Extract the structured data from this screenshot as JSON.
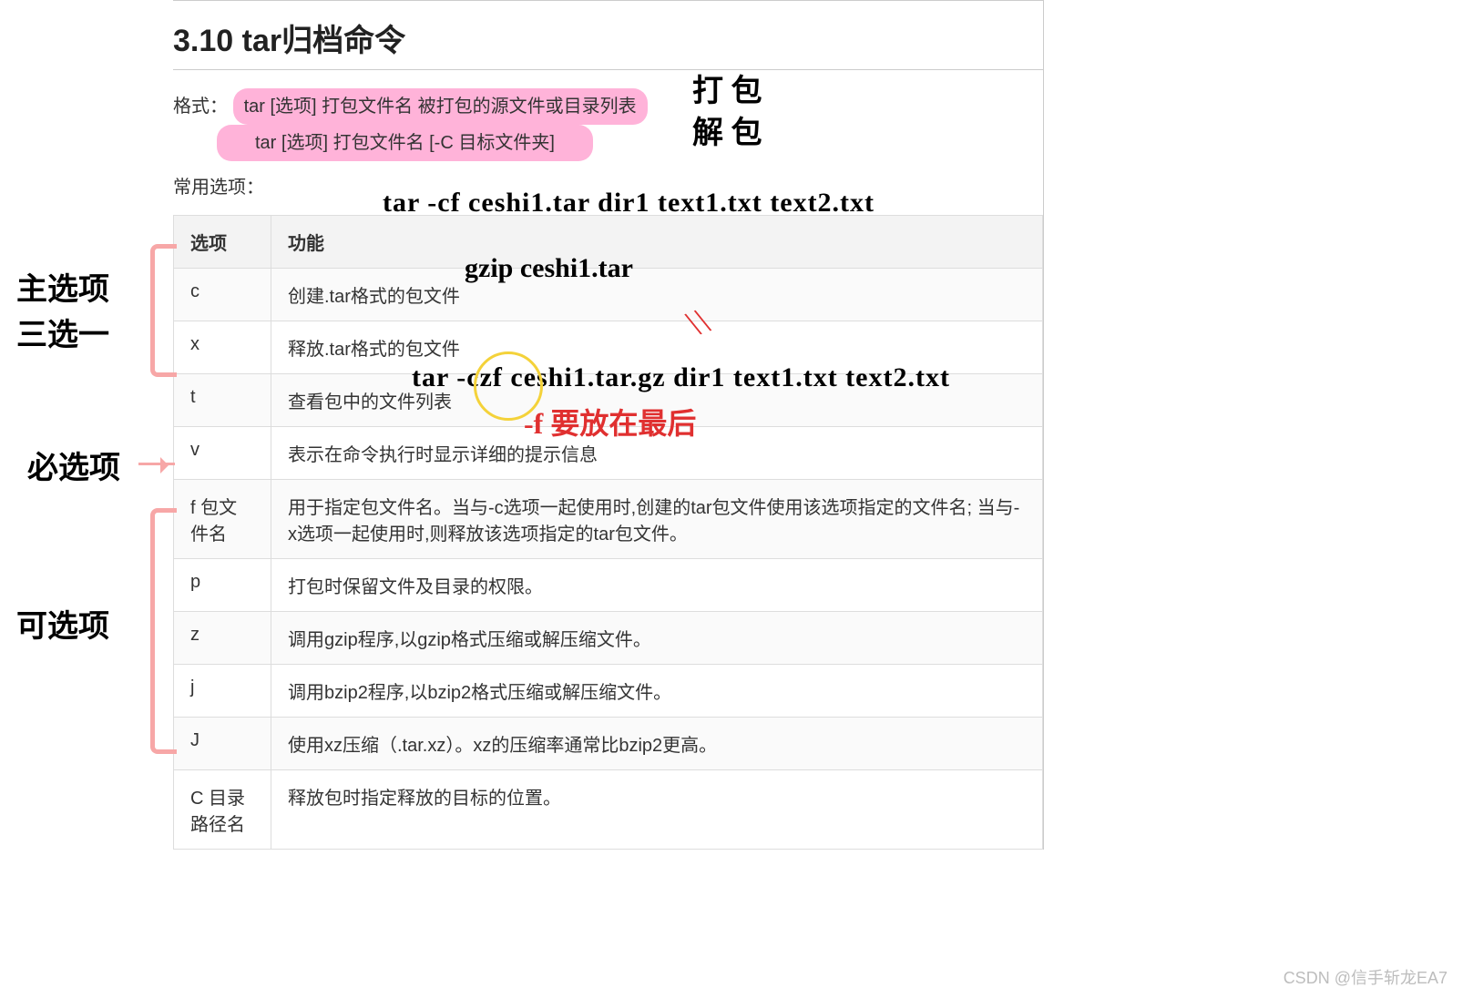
{
  "heading": "3.10 tar归档命令",
  "format_label": "格式：",
  "format_line1": "tar  [选项]  打包文件名  被打包的源文件或目录列表",
  "format_line2": "tar  [选项]  打包文件名  [-C  目标文件夹]",
  "common_opts_label": "常用选项：",
  "table": {
    "head_option": "选项",
    "head_function": "功能",
    "rows": [
      {
        "opt": "c",
        "desc": "创建.tar格式的包文件"
      },
      {
        "opt": "x",
        "desc": "释放.tar格式的包文件"
      },
      {
        "opt": "t",
        "desc": "查看包中的文件列表"
      },
      {
        "opt": "v",
        "desc": "表示在命令执行时显示详细的提示信息"
      },
      {
        "opt": "f 包文件名",
        "desc": "用于指定包文件名。当与-c选项一起使用时,创建的tar包文件使用该选项指定的文件名; 当与-x选项一起使用时,则释放该选项指定的tar包文件。"
      },
      {
        "opt": "p",
        "desc": "打包时保留文件及目录的权限。"
      },
      {
        "opt": "z",
        "desc": "调用gzip程序,以gzip格式压缩或解压缩文件。"
      },
      {
        "opt": "j",
        "desc": "调用bzip2程序,以bzip2格式压缩或解压缩文件。"
      },
      {
        "opt": "J",
        "desc": "使用xz压缩（.tar.xz）。xz的压缩率通常比bzip2更高。"
      },
      {
        "opt": "C 目录路径名",
        "desc": "释放包时指定释放的目标的位置。"
      }
    ]
  },
  "annotations": {
    "pack": "打 包",
    "unpack": "解 包",
    "cmd1": "tar -cf ceshi1.tar dir1 text1.txt text2.txt",
    "cmd2": "gzip ceshi1.tar",
    "cmd3": "tar -czf ceshi1.tar.gz dir1 text1.txt text2.txt",
    "f_note": "-f 要放在最后",
    "main_opt": "主选项",
    "three_choose_one": "三选一",
    "must_opt": "必选项",
    "optional_opt": "可选项"
  },
  "watermark": "CSDN @信手斩龙EA7"
}
